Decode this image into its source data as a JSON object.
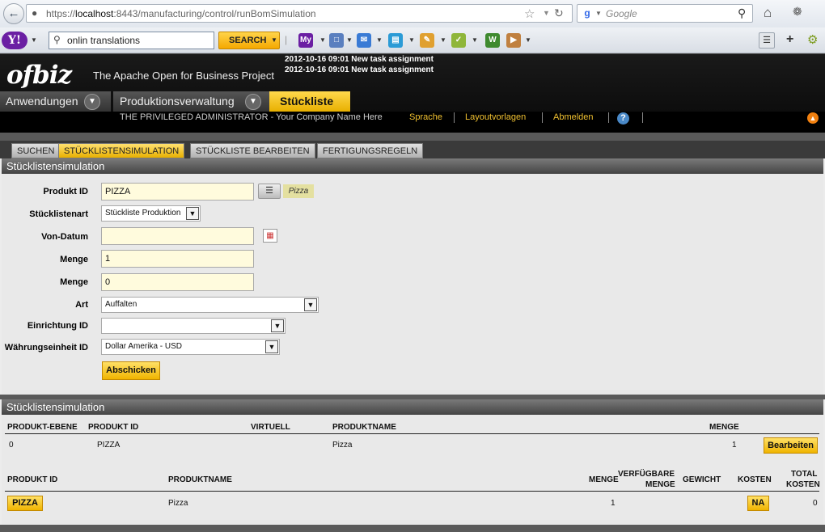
{
  "browser": {
    "url_prefix": "https://",
    "url_host": "localhost",
    "url_rest": ":8443/manufacturing/control/runBomSimulation",
    "search_placeholder": "Google"
  },
  "yahoo_toolbar": {
    "logo": "Y!",
    "search_value": "onlin translations",
    "search_button": "SEARCH",
    "icon_labels": [
      "My",
      "W"
    ]
  },
  "header": {
    "logo": "ofbiz",
    "tagline": "The Apache Open for Business Project",
    "messages": [
      "2012-10-16 09:01 New task assignment",
      "2012-10-16 09:01 New task assignment"
    ]
  },
  "app_tabs": {
    "applications": "Anwendungen",
    "manufacturing": "Produktionsverwaltung",
    "active": "Stückliste"
  },
  "user_bar": {
    "user": "THE PRIVILEGED ADMINISTRATOR - Your Company Name Here",
    "language": "Sprache",
    "layouts": "Layoutvorlagen",
    "logout": "Abmelden",
    "help": "?"
  },
  "sub_tabs": [
    "Suchen",
    "Stücklistensimulation",
    "Stückliste bearbeiten",
    "Fertigungsregeln"
  ],
  "form": {
    "title": "Stücklistensimulation",
    "product_id_label": "Produkt ID",
    "product_id_value": "PIZZA",
    "product_tip": "Pizza",
    "bom_type_label": "Stücklistenart",
    "bom_type_value": "Stückliste Produktion",
    "from_date_label": "Von-Datum",
    "from_date_value": "",
    "quantity1_label": "Menge",
    "quantity1_value": "1",
    "quantity2_label": "Menge",
    "quantity2_value": "0",
    "type_label": "Art",
    "type_value": "Auffalten",
    "facility_label": "Einrichtung ID",
    "facility_value": "",
    "currency_label": "Währungseinheit ID",
    "currency_value": "Dollar Amerika - USD",
    "submit": "Abschicken"
  },
  "results": {
    "title": "Stücklistensimulation",
    "table1": {
      "headers": [
        "PRODUKT-EBENE",
        "PRODUKT ID",
        "VIRTUELL",
        "PRODUKTNAME",
        "MENGE"
      ],
      "row": {
        "level": "0",
        "product_id": "PIZZA",
        "virtual": "",
        "name": "Pizza",
        "quantity": "1",
        "action": "Bearbeiten"
      }
    },
    "table2": {
      "headers": [
        "PRODUKT ID",
        "PRODUKTNAME",
        "MENGE",
        "VERFÜGBARE",
        "MENGE",
        "GEWICHT",
        "KOSTEN",
        "TOTAL",
        "KOSTEN"
      ],
      "row": {
        "product_id": "PIZZA",
        "name": "Pizza",
        "quantity": "1",
        "available": "",
        "weight": "",
        "cost": "NA",
        "total_cost": "0"
      }
    }
  }
}
